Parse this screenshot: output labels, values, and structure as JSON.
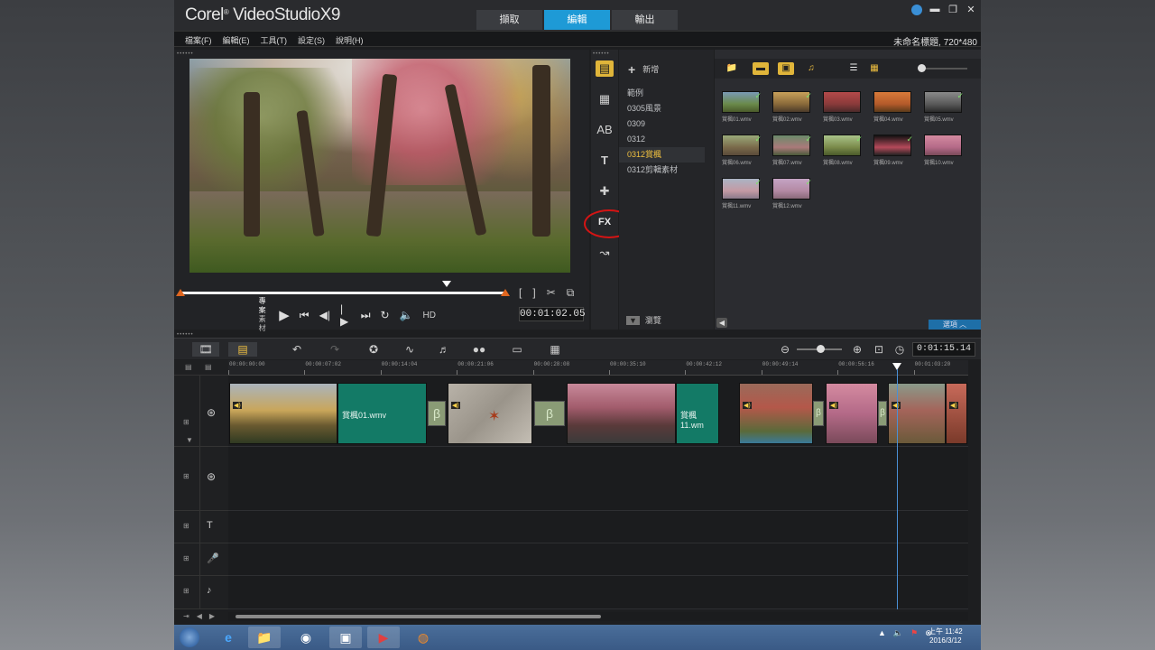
{
  "app": {
    "logo_a": "Corel",
    "logo_b": "VideoStudio",
    "logo_c": "X9",
    "tabs": [
      "擷取",
      "編輯",
      "輸出"
    ],
    "active_tab": "編輯",
    "project_info": "未命名標題, 720*480"
  },
  "menu": [
    "檔案(F)",
    "編輯(E)",
    "工具(T)",
    "設定(S)",
    "說明(H)"
  ],
  "player": {
    "mode_project": "專案",
    "mode_clip": "素材",
    "hd_label": "HD",
    "timecode": "00:01:02.05"
  },
  "library": {
    "add_label": "新增",
    "folders": [
      "範例",
      "0305風景",
      "0309",
      "0312",
      "0312賞楓",
      "0312剪輯素材"
    ],
    "selected_folder": "0312賞楓",
    "browse_label": "瀏覽",
    "options_label": "選項",
    "fx_label": "FX",
    "thumbnails": [
      {
        "name": "賞楓01.wmv",
        "checked": true
      },
      {
        "name": "賞楓02.wmv",
        "checked": true
      },
      {
        "name": "賞楓03.wmv",
        "checked": false
      },
      {
        "name": "賞楓04.wmv",
        "checked": false
      },
      {
        "name": "賞楓05.wmv",
        "checked": true
      },
      {
        "name": "賞楓06.wmv",
        "checked": true
      },
      {
        "name": "賞楓07.wmv",
        "checked": true
      },
      {
        "name": "賞楓08.wmv",
        "checked": true
      },
      {
        "name": "賞楓09.wmv",
        "checked": true
      },
      {
        "name": "賞楓10.wmv",
        "checked": false
      },
      {
        "name": "賞楓11.wmv",
        "checked": true
      },
      {
        "name": "賞楓12.wmv",
        "checked": true
      }
    ]
  },
  "timeline": {
    "timecode": "0:01:15.14",
    "ruler": [
      "00:00:00:00",
      "00:00:07:02",
      "00:00:14:04",
      "00:00:21:06",
      "00:00:28:08",
      "00:00:35:10",
      "00:00:42:12",
      "00:00:49:14",
      "00:00:56:16",
      "00:01:03:20"
    ],
    "clip_labels": [
      "賞楓01.wmv",
      "賞楓11.wm"
    ]
  },
  "taskbar": {
    "time": "上午 11:42",
    "date": "2016/3/12"
  },
  "colors": {
    "accent_tab": "#1e9ad6",
    "teal_clip": "#137a66",
    "highlight_ring": "#d41414"
  }
}
